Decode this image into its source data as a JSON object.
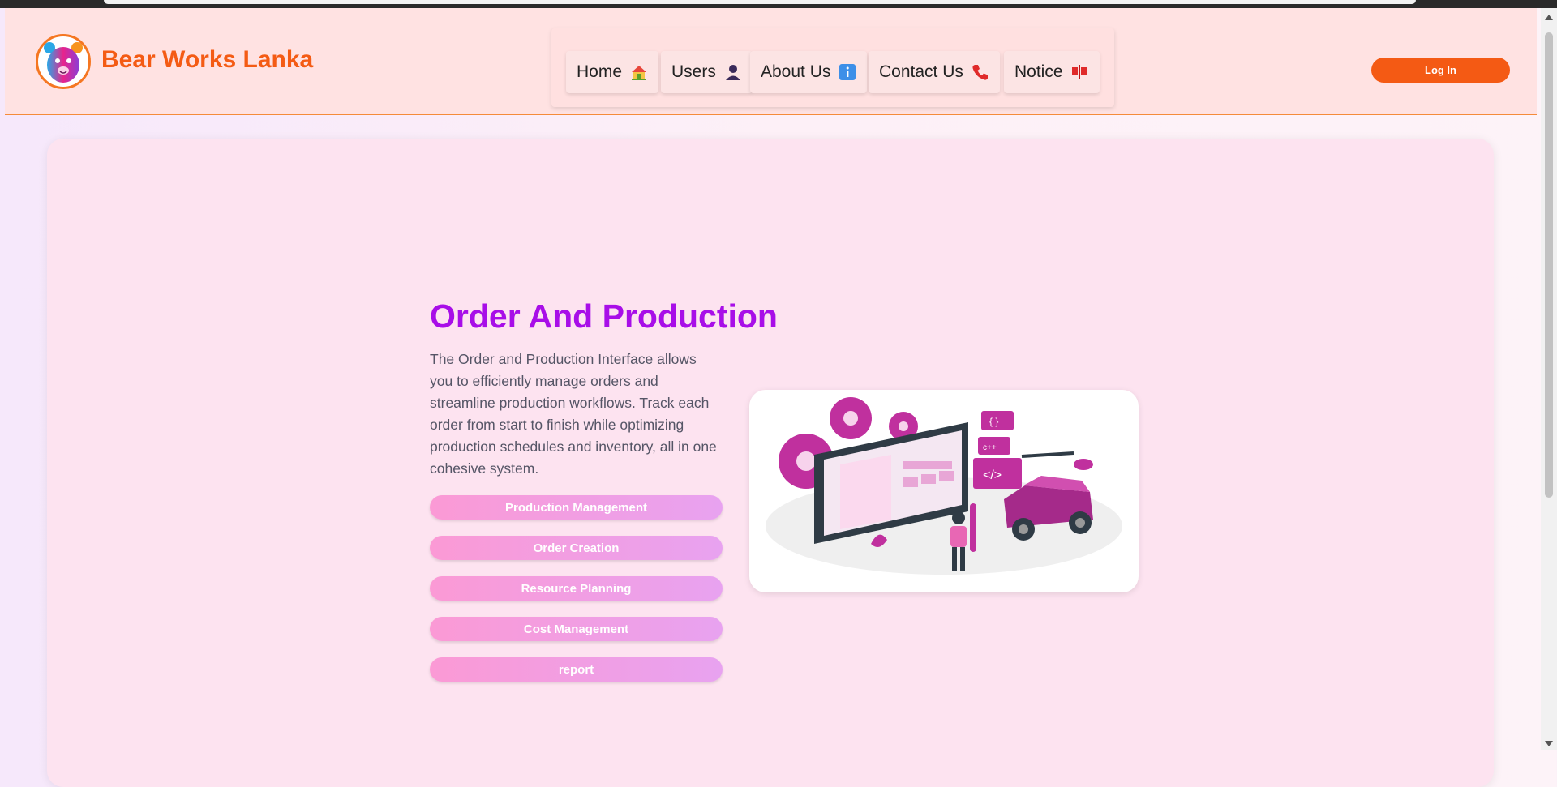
{
  "brand": {
    "name": "Bear Works Lanka"
  },
  "nav": {
    "items": [
      {
        "label": "Home",
        "icon": "house-icon"
      },
      {
        "label": "Users",
        "icon": "user-icon"
      },
      {
        "label": "About Us",
        "icon": "info-icon"
      },
      {
        "label": "Contact Us",
        "icon": "phone-icon"
      },
      {
        "label": "Notice",
        "icon": "flag-icon"
      }
    ],
    "login_label": "Log In"
  },
  "hero": {
    "title": "Order And Production",
    "description": "The Order and Production Interface allows you to efficiently manage orders and streamline production workflows. Track each order from start to finish while optimizing production schedules and inventory, all in one cohesive system.",
    "buttons": [
      "Production Management",
      "Order Creation",
      "Resource Planning",
      "Cost Management",
      "report"
    ]
  },
  "colors": {
    "brand_orange": "#f45a14",
    "title_purple": "#a80ee8",
    "navbar_bg": "#ffe2e2",
    "card_bg": "#fde3f0"
  }
}
